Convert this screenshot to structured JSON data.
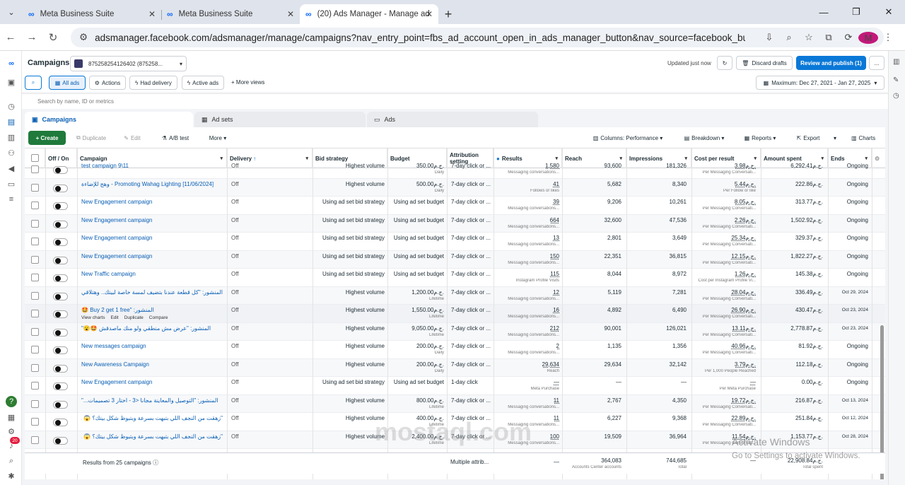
{
  "browser": {
    "tabs": [
      {
        "title": "Meta Business Suite"
      },
      {
        "title": "Meta Business Suite"
      },
      {
        "title": "(20) Ads Manager - Manage ad"
      }
    ],
    "url": "adsmanager.facebook.com/adsmanager/manage/campaigns?nav_entry_point=fbs_ad_account_open_in_ads_manager_button&nav_source=facebook_business_suite&tool=MA...",
    "avatar_letter": "M"
  },
  "leftnav": {
    "badge": "20"
  },
  "header": {
    "title": "Campaigns",
    "account": "875258254126402 (875258...",
    "updated": "Updated just now",
    "discard": "Discard drafts",
    "review": "Review and publish (1)",
    "more": "..."
  },
  "filters": {
    "all_ads": "All ads",
    "actions": "Actions",
    "had_delivery": "Had delivery",
    "active_ads": "Active ads",
    "more_views": "More views",
    "date_range": "Maximum: Dec 27, 2021 - Jan 27, 2025"
  },
  "search": {
    "placeholder": "Search by name, ID or metrics"
  },
  "tabs": {
    "campaigns": "Campaigns",
    "adsets": "Ad sets",
    "ads": "Ads"
  },
  "toolbar": {
    "create": "Create",
    "duplicate": "Duplicate",
    "edit": "Edit",
    "ab_test": "A/B test",
    "more": "More",
    "columns": "Columns: Performance",
    "breakdown": "Breakdown",
    "reports": "Reports",
    "export": "Export",
    "charts": "Charts"
  },
  "columns": {
    "off_on": "Off / On",
    "campaign": "Campaign",
    "delivery": "Delivery",
    "bid_strategy": "Bid strategy",
    "budget": "Budget",
    "attribution": "Attribution setting",
    "results": "Results",
    "reach": "Reach",
    "impressions": "Impressions",
    "cost_per_result": "Cost per result",
    "amount_spent": "Amount spent",
    "ends": "Ends"
  },
  "rows": [
    {
      "name": "test campaign 9\\11",
      "delivery": "Off",
      "bid": "Highest volume",
      "budget": "350.00ج.م.",
      "budget_sub": "Daily",
      "attr": "7-day click or ...",
      "results": "1,580",
      "results_sub": "Messaging conversations...",
      "reach": "93,600",
      "impr": "181,326",
      "cpr": "3.98ج.م.",
      "cpr_sub": "Per Messaging Conversati...",
      "spent": "6,292.41ج.م.",
      "ends": "Ongoing"
    },
    {
      "name": "[11/06/2024] Promoting Wahag Lighting - وهج للإضاءة",
      "delivery": "Off",
      "bid": "Highest volume",
      "budget": "500.00ج.م.",
      "budget_sub": "Daily",
      "attr": "7-day click or ...",
      "results": "41",
      "results_sub": "Follows or likes",
      "reach": "5,682",
      "impr": "8,340",
      "cpr": "5.44ج.م.",
      "cpr_sub": "Per Follow or like",
      "spent": "222.86ج.م.",
      "ends": "Ongoing"
    },
    {
      "name": "New Engagement campaign",
      "delivery": "Off",
      "bid": "Using ad set bid strategy",
      "budget": "Using ad set budget",
      "budget_sub": "",
      "attr": "7-day click or ...",
      "results": "39",
      "results_sub": "Messaging conversations...",
      "reach": "9,206",
      "impr": "10,261",
      "cpr": "8.05ج.م.",
      "cpr_sub": "Per Messaging Conversati...",
      "spent": "313.77ج.م.",
      "ends": "Ongoing"
    },
    {
      "name": "New Engagement campaign",
      "delivery": "Off",
      "bid": "Using ad set bid strategy",
      "budget": "Using ad set budget",
      "budget_sub": "",
      "attr": "7-day click or ...",
      "results": "664",
      "results_sub": "Messaging conversations...",
      "reach": "32,600",
      "impr": "47,536",
      "cpr": "2.26ج.م.",
      "cpr_sub": "Per Messaging Conversati...",
      "spent": "1,502.92ج.م.",
      "ends": "Ongoing"
    },
    {
      "name": "New Engagement campaign",
      "delivery": "Off",
      "bid": "Using ad set bid strategy",
      "budget": "Using ad set budget",
      "budget_sub": "",
      "attr": "7-day click or ...",
      "results": "13",
      "results_sub": "Messaging conversations...",
      "reach": "2,801",
      "impr": "3,649",
      "cpr": "25.34ج.م.",
      "cpr_sub": "Per Messaging Conversati...",
      "spent": "329.37ج.م.",
      "ends": "Ongoing"
    },
    {
      "name": "New Engagement campaign",
      "delivery": "Off",
      "bid": "Using ad set bid strategy",
      "budget": "Using ad set budget",
      "budget_sub": "",
      "attr": "7-day click or ...",
      "results": "150",
      "results_sub": "Messaging conversations...",
      "reach": "22,351",
      "impr": "36,815",
      "cpr": "12.15ج.م.",
      "cpr_sub": "Per Messaging Conversati...",
      "spent": "1,822.27ج.م.",
      "ends": "Ongoing"
    },
    {
      "name": "New Traffic campaign",
      "delivery": "Off",
      "bid": "Using ad set bid strategy",
      "budget": "Using ad set budget",
      "budget_sub": "",
      "attr": "7-day click or ...",
      "results": "115",
      "results_sub": "Instagram Profile Visits",
      "reach": "8,044",
      "impr": "8,972",
      "cpr": "1.26ج.م.",
      "cpr_sub": "Cost per Instagram Profile Vi...",
      "spent": "145.38ج.م.",
      "ends": "Ongoing"
    },
    {
      "name": "المنشور: \"كل قطعة عندنا بتضيف لمسة خاصة لبيتك.. وهتلاقي...\"",
      "delivery": "Off",
      "bid": "Highest volume",
      "budget": "1,200.00ج.م.",
      "budget_sub": "Lifetime",
      "attr": "7-day click or ...",
      "results": "12",
      "results_sub": "Messaging conversations...",
      "reach": "5,119",
      "impr": "7,281",
      "cpr": "28.04ج.م.",
      "cpr_sub": "Per Messaging Conversati...",
      "spent": "336.49ج.م.",
      "ends": "Oct 29, 2024"
    },
    {
      "name": "المنشور: \"Buy 2 get 1 free 🤩",
      "delivery": "Off",
      "bid": "Highest volume",
      "budget": "1,550.00ج.م.",
      "budget_sub": "Lifetime",
      "attr": "7-day click or ...",
      "results": "16",
      "results_sub": "Messaging conversations...",
      "reach": "4,892",
      "impr": "6,490",
      "cpr": "26.90ج.م.",
      "cpr_sub": "Per Messaging Conversati...",
      "spent": "430.47ج.م.",
      "ends": "Oct 23, 2024",
      "hover": true
    },
    {
      "name": "المنشور: \"عرض مش منطقي ولو منك ماصدقش 🤩😮\"",
      "delivery": "Off",
      "bid": "Highest volume",
      "budget": "9,050.00ج.م.",
      "budget_sub": "Lifetime",
      "attr": "7-day click or ...",
      "results": "212",
      "results_sub": "Messaging conversations...",
      "reach": "90,001",
      "impr": "126,021",
      "cpr": "13.11ج.م.",
      "cpr_sub": "Per Messaging Conversati...",
      "spent": "2,778.87ج.م.",
      "ends": "Oct 23, 2024"
    },
    {
      "name": "New messages campaign",
      "delivery": "Off",
      "bid": "Highest volume",
      "budget": "200.00ج.م.",
      "budget_sub": "Daily",
      "attr": "7-day click or ...",
      "results": "2",
      "results_sub": "Messaging conversations...",
      "reach": "1,135",
      "impr": "1,356",
      "cpr": "40.96ج.م.",
      "cpr_sub": "Per Messaging Conversati...",
      "spent": "81.92ج.م.",
      "ends": "Ongoing"
    },
    {
      "name": "New Awareness Campaign",
      "delivery": "Off",
      "bid": "Highest volume",
      "budget": "200.00ج.م.",
      "budget_sub": "Daily",
      "attr": "7-day click or ...",
      "results": "29,634",
      "results_sub": "Reach",
      "reach": "29,634",
      "impr": "32,142",
      "cpr": "3.79ج.م.",
      "cpr_sub": "Per 1,000 People Reached",
      "spent": "112.18ج.م.",
      "ends": "Ongoing"
    },
    {
      "name": "New Engagement campaign",
      "delivery": "Off",
      "bid": "Using ad set bid strategy",
      "budget": "Using ad set budget",
      "budget_sub": "",
      "attr": "1-day click",
      "results": "—",
      "results_sub": "Meta Purchase",
      "reach": "—",
      "impr": "—",
      "cpr": "—",
      "cpr_sub": "Per Meta Purchase",
      "spent": "0.00ج.م.",
      "ends": "Ongoing"
    },
    {
      "name": "المنشور: \"التوصيل والمعاينة مجانا <3 - اختار 3 تصميمات...\"",
      "delivery": "Off",
      "bid": "Highest volume",
      "budget": "800.00ج.م.",
      "budget_sub": "Lifetime",
      "attr": "7-day click or ...",
      "results": "11",
      "results_sub": "Messaging conversations...",
      "reach": "2,767",
      "impr": "4,350",
      "cpr": "19.72ج.م.",
      "cpr_sub": "Per Messaging Conversati...",
      "spent": "216.87ج.م.",
      "ends": "Oct 13, 2024"
    },
    {
      "name": "\"زهقت من النجف اللي بتبهت بسرعة وبتبوظ شكل بيتك؟ 😱 ...",
      "delivery": "Off",
      "bid": "Highest volume",
      "budget": "400.00ج.م.",
      "budget_sub": "Lifetime",
      "attr": "7-day click or ...",
      "results": "11",
      "results_sub": "Messaging conversations...",
      "reach": "6,227",
      "impr": "9,368",
      "cpr": "22.89ج.م.",
      "cpr_sub": "Per Messaging Conversati...",
      "spent": "251.84ج.م.",
      "ends": "Oct 12, 2024"
    },
    {
      "name": "\"زهقت من النجف اللي بتبهت بسرعة وبتبوظ شكل بيتك؟ 😱 ...",
      "delivery": "Off",
      "bid": "Highest volume",
      "budget": "2,400.00ج.م.",
      "budget_sub": "Lifetime",
      "attr": "7-day click or ...",
      "results": "100",
      "results_sub": "Messaging conversations...",
      "reach": "19,509",
      "impr": "36,964",
      "cpr": "11.54ج.م.",
      "cpr_sub": "Per Messaging Conversati...",
      "spent": "1,153.77ج.م.",
      "ends": "Oct 28, 2024"
    }
  ],
  "hover_actions": {
    "view_charts": "View charts",
    "edit": "Edit",
    "duplicate": "Duplicate",
    "compare": "Compare"
  },
  "footer": {
    "label": "Results from 25 campaigns",
    "attr": "Multiple attrib...",
    "results": "—",
    "reach": "364,083",
    "reach_sub": "Accounts Center accounts",
    "impr": "744,685",
    "impr_sub": "Total",
    "cpr": "—",
    "spent": "22,908.84ج.م.",
    "spent_sub": "Total spent"
  },
  "watermark": {
    "text": "mostaql.com",
    "activate": "Activate Windows",
    "activate_sub": "Go to Settings to activate Windows."
  }
}
